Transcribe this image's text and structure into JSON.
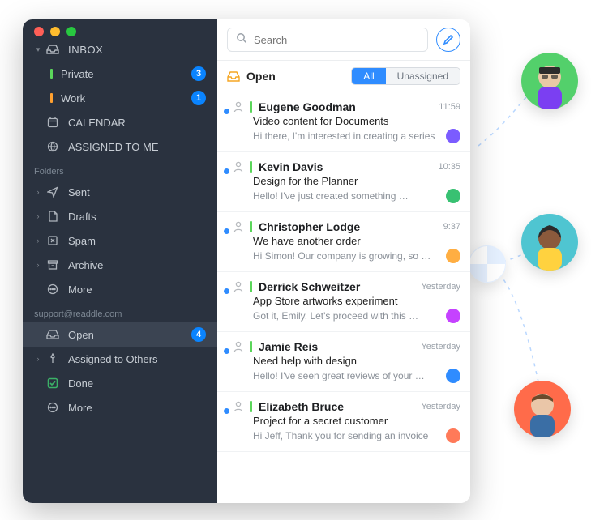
{
  "sidebar": {
    "inbox_label": "INBOX",
    "private": {
      "label": "Private",
      "color": "#5BD65B",
      "badge": "3"
    },
    "work": {
      "label": "Work",
      "color": "#FFA02F",
      "badge": "1"
    },
    "calendar_label": "CALENDAR",
    "assigned_label": "ASSIGNED TO ME",
    "folders_label": "Folders",
    "folders": {
      "sent": "Sent",
      "drafts": "Drafts",
      "spam": "Spam",
      "archive": "Archive",
      "more": "More"
    },
    "account_label": "support@readdle.com",
    "account": {
      "open": {
        "label": "Open",
        "badge": "4"
      },
      "assigned_others": "Assigned to Others",
      "done": "Done",
      "more": "More"
    }
  },
  "search": {
    "placeholder": "Search"
  },
  "listhead": {
    "title": "Open",
    "seg_all": "All",
    "seg_unassigned": "Unassigned"
  },
  "messages": [
    {
      "sender": "Eugene Goodman",
      "bar": "#5BD65B",
      "subject": "Video content for Documents",
      "preview": "Hi there, I'm interested in creating a series",
      "time": "11:59",
      "avatar": "#7B5CFF"
    },
    {
      "sender": "Kevin Davis",
      "bar": "#5BD65B",
      "subject": "Design for the Planner",
      "preview": "Hello! I've just created something …",
      "time": "10:35",
      "avatar": "#38C172"
    },
    {
      "sender": "Christopher Lodge",
      "bar": "#5BD65B",
      "subject": "We have another order",
      "preview": "Hi Simon! Our company is growing, so …",
      "time": "9:37",
      "avatar": "#FFAE42"
    },
    {
      "sender": "Derrick Schweitzer",
      "bar": "#5BD65B",
      "subject": "App Store artworks experiment",
      "preview": "Got it, Emily. Let's proceed with this …",
      "time": "Yesterday",
      "avatar": "#C542FF"
    },
    {
      "sender": "Jamie Reis",
      "bar": "#5BD65B",
      "subject": "Need help with design",
      "preview": "Hello! I've seen great reviews of your …",
      "time": "Yesterday",
      "avatar": "#2F8CFF"
    },
    {
      "sender": "Elizabeth Bruce",
      "bar": "#5BD65B",
      "subject": "Project for a secret customer",
      "preview": "Hi Jeff, Thank you for sending an invoice",
      "time": "Yesterday",
      "avatar": "#FF7A59"
    }
  ],
  "team_avatars": [
    {
      "bg": "#53D06B"
    },
    {
      "bg": "#4FC5D1"
    },
    {
      "bg": "#FF6B4A"
    }
  ]
}
